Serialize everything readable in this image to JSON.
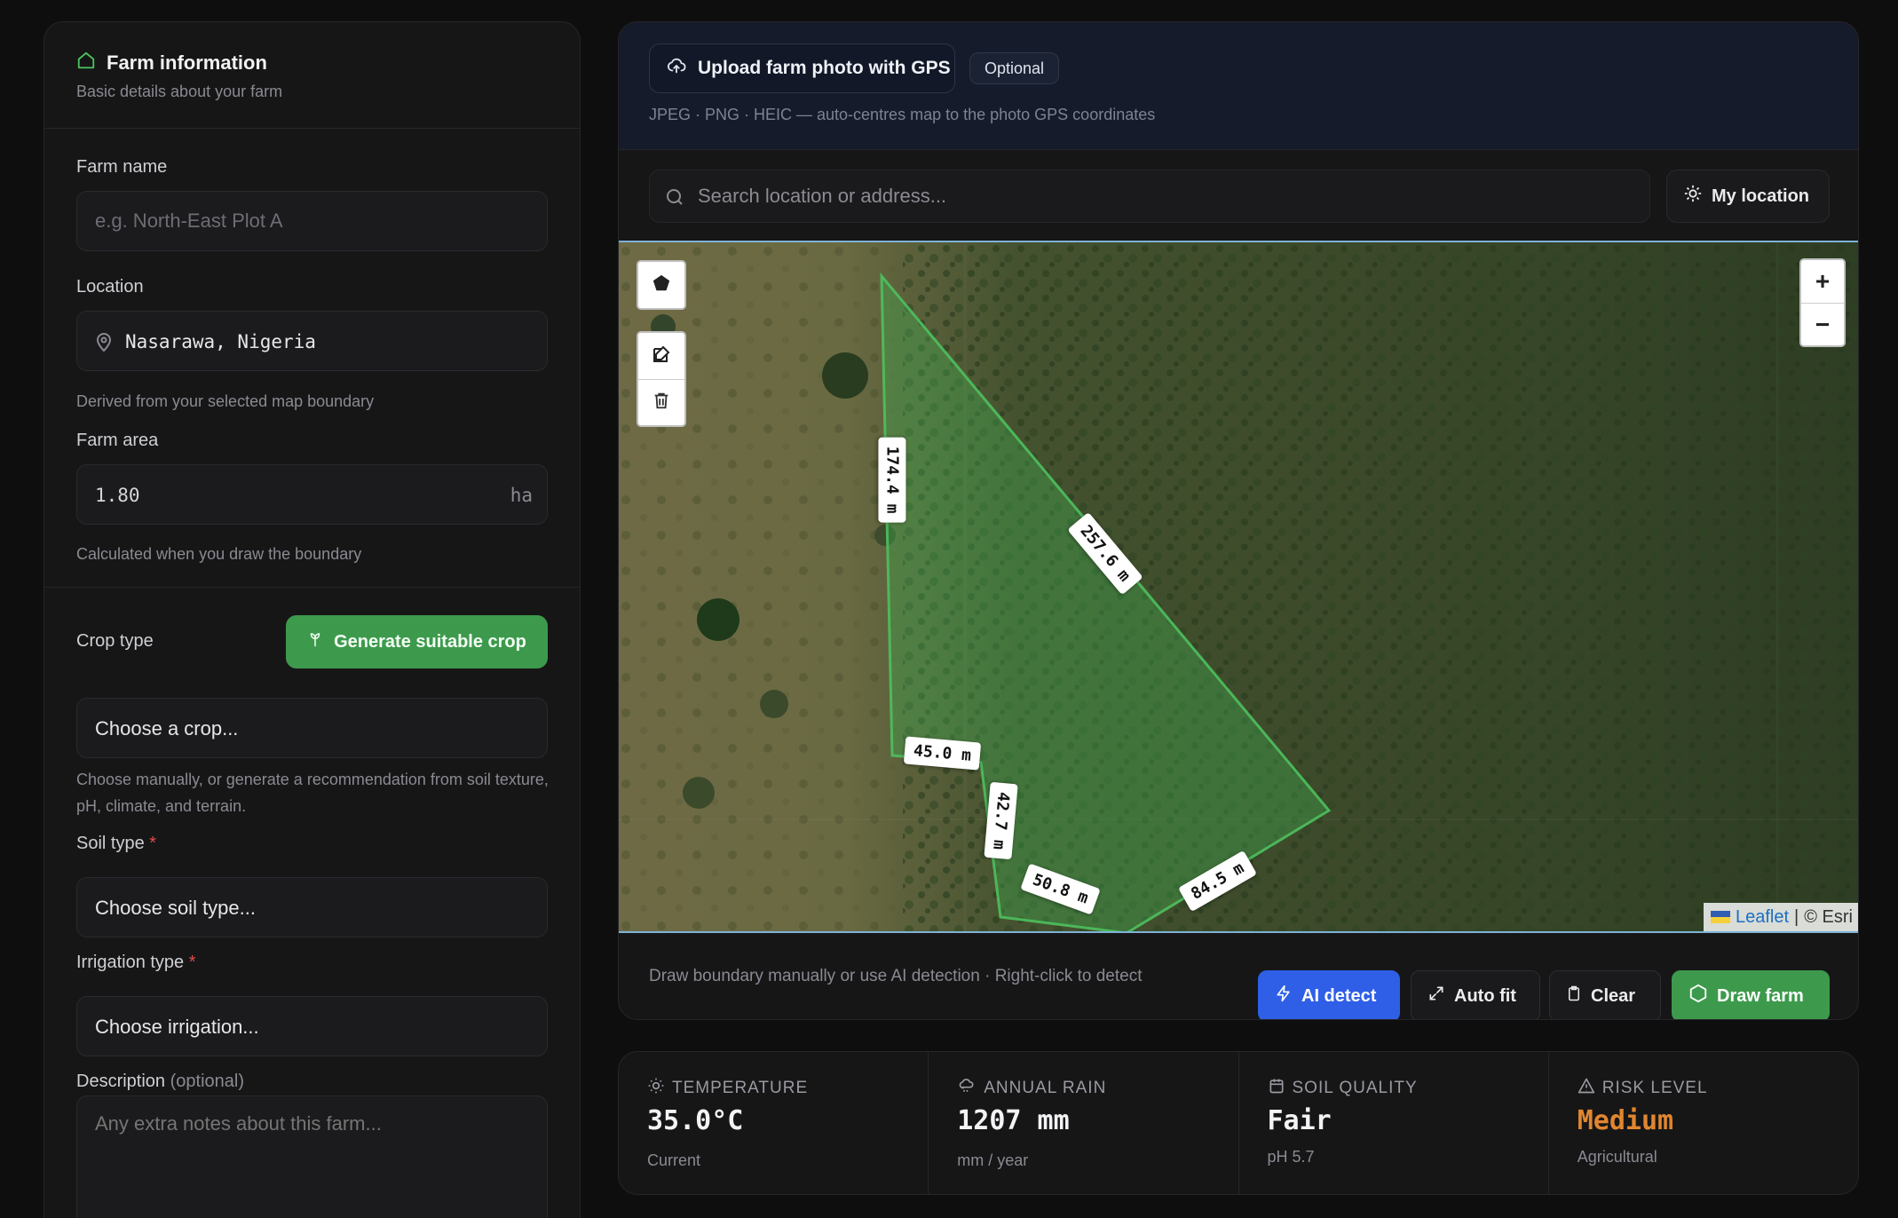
{
  "farm_info": {
    "title": "Farm information",
    "subtitle": "Basic details about your farm",
    "farm_name": {
      "label": "Farm name",
      "placeholder": "e.g. North-East Plot A",
      "value": ""
    },
    "location": {
      "label": "Location",
      "value": "Nasarawa, Nigeria",
      "hint": "Derived from your selected map boundary"
    },
    "farm_area": {
      "label": "Farm area",
      "value": "1.80",
      "unit": "ha",
      "hint": "Calculated when you draw the boundary"
    },
    "crop_type": {
      "label": "Crop type",
      "generate_button": "Generate suitable crop",
      "selected": "Choose a crop...",
      "hint": "Choose manually, or generate a recommendation from soil texture, pH, climate, and terrain."
    },
    "soil_type": {
      "label": "Soil type",
      "required": "*",
      "selected": "Choose soil type..."
    },
    "irrigation_type": {
      "label": "Irrigation type",
      "required": "*",
      "selected": "Choose irrigation..."
    },
    "description": {
      "label": "Description",
      "optional": "(optional)",
      "placeholder": "Any extra notes about this farm..."
    }
  },
  "upload": {
    "button_label": "Upload farm photo with GPS",
    "badge": "Optional",
    "hint": "JPEG · PNG · HEIC — auto-centres map to the photo GPS coordinates"
  },
  "search": {
    "placeholder": "Search location or address...",
    "my_location_label": "My location"
  },
  "map": {
    "measurements": [
      "174.4 m",
      "257.6 m",
      "45.0 m",
      "42.7 m",
      "50.8 m",
      "84.5 m"
    ],
    "zoom_in": "+",
    "zoom_out": "−",
    "attribution_leaflet": "Leaflet",
    "attribution_sep": "|",
    "attribution_esri": "© Esri",
    "polygon_color": "#3fae52"
  },
  "map_footer": {
    "hint": "Draw boundary manually or use AI detection · Right-click to detect",
    "ai_detect": "AI detect",
    "auto_fit": "Auto fit",
    "clear": "Clear",
    "draw_farm": "Draw farm"
  },
  "stats": [
    {
      "label": "TEMPERATURE",
      "value": "35.0°C",
      "sub": "Current",
      "icon": "sun-icon"
    },
    {
      "label": "ANNUAL RAIN",
      "value": "1207 mm",
      "sub": "mm / year",
      "icon": "cloud-rain-icon"
    },
    {
      "label": "SOIL QUALITY",
      "value": "Fair",
      "sub": "pH 5.7",
      "icon": "calendar-icon"
    },
    {
      "label": "RISK LEVEL",
      "value": "Medium",
      "sub": "Agricultural",
      "icon": "warning-icon"
    }
  ],
  "colors": {
    "accent_green": "#3d9a4c",
    "accent_blue": "#2e5fe6",
    "risk_orange": "#e0862f",
    "required_red": "#e24b4b"
  }
}
